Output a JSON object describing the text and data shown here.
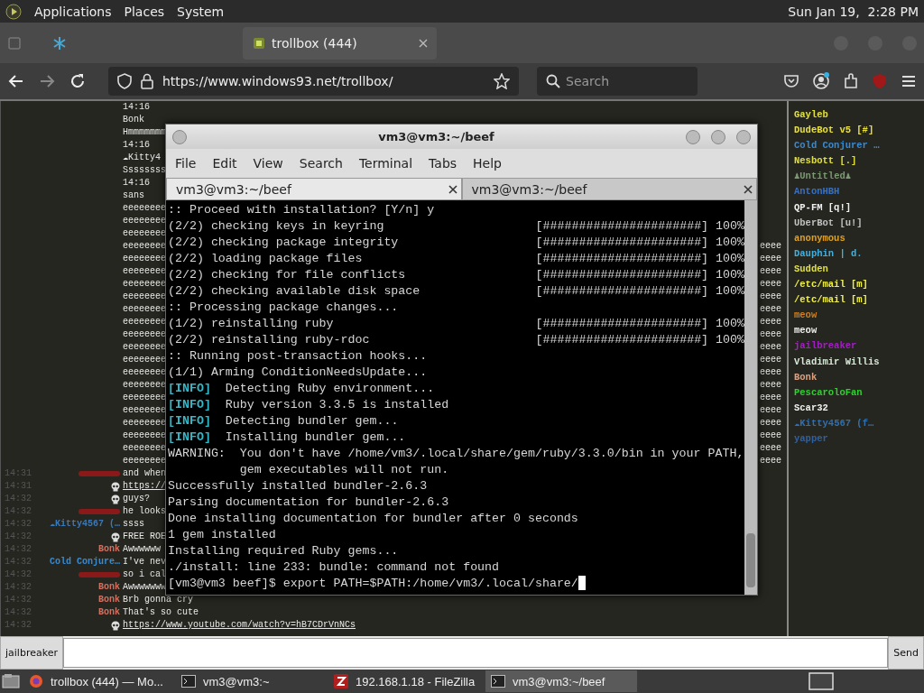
{
  "panel": {
    "menus": [
      "Applications",
      "Places",
      "System"
    ],
    "clock": "Sun Jan 19,  2:28 PM"
  },
  "browser": {
    "tabs": [
      {
        "selected": false
      },
      {
        "title": "trollbox (444)",
        "selected": true
      }
    ],
    "url": "https://www.windows93.net/trollbox/",
    "search": {
      "placeholder": "Search"
    }
  },
  "chat": {
    "lines": [
      {
        "text": "14:16"
      },
      {
        "text": "Bonk"
      },
      {
        "text": "Hmmmmmmm"
      },
      {
        "text": "14:16"
      },
      {
        "text": "☁Kitty4"
      },
      {
        "text": "Ssssssss"
      },
      {
        "text": "14:16"
      },
      {
        "text": "sans"
      },
      {
        "text": "eeeeeeee"
      },
      {
        "text": "eeeeeeee"
      },
      {
        "text": "eeeeeeee"
      },
      {
        "text": "eeeeeeee",
        "tail": "eeee"
      },
      {
        "text": "eeeeeeee",
        "tail": "eeee"
      },
      {
        "text": "eeeeeeee",
        "tail": "eeee"
      },
      {
        "text": "eeeeeeee",
        "tail": "eeee"
      },
      {
        "text": "eeeeeeee",
        "tail": "eeee"
      },
      {
        "text": "eeeeeeee",
        "tail": "eeee"
      },
      {
        "text": "eeeeeeee",
        "tail": "eeee"
      },
      {
        "text": "eeeeeeee",
        "tail": "eeee"
      },
      {
        "text": "eeeeeeee",
        "tail": "eeee"
      },
      {
        "text": "eeeeeeee",
        "tail": "eeee"
      },
      {
        "text": "eeeeeeee",
        "tail": "eeee"
      },
      {
        "text": "eeeeeeee",
        "tail": "eeee"
      },
      {
        "text": "eeeeeeee",
        "tail": "eeee"
      },
      {
        "text": "eeeeeeee",
        "tail": "eeee"
      },
      {
        "text": "eeeeeeee",
        "tail": "eeee"
      },
      {
        "text": "eeeeeeee",
        "tail": "eeee"
      },
      {
        "text": "eeeeeeee",
        "tail": "eeee"
      },
      {
        "text": "eeeeeeee",
        "tail": "eeee"
      }
    ],
    "messages": [
      {
        "time": "14:31",
        "kind": "hidden",
        "text": "and when"
      },
      {
        "time": "14:31",
        "kind": "skull",
        "text": "https://",
        "link": true
      },
      {
        "time": "14:32",
        "kind": "skull",
        "text": "guys?"
      },
      {
        "time": "14:32",
        "kind": "hidden",
        "text": "he looks"
      },
      {
        "time": "14:32",
        "kind": "name",
        "name": "☁Kitty4567 (…",
        "color": "#3a78b8",
        "text": "ssss"
      },
      {
        "time": "14:32",
        "kind": "skull",
        "text": "FREE ROE"
      },
      {
        "time": "14:32",
        "kind": "name",
        "name": "Bonk",
        "color": "#d07060",
        "text": "Awwwwww"
      },
      {
        "time": "14:32",
        "kind": "name",
        "name": "Cold Conjure…",
        "color": "#3a8ad0",
        "text": "I've nev"
      },
      {
        "time": "14:32",
        "kind": "hidden",
        "text": "so i cal"
      },
      {
        "time": "14:32",
        "kind": "name",
        "name": "Bonk",
        "color": "#d07060",
        "text": "Awwwwwww"
      },
      {
        "time": "14:32",
        "kind": "name",
        "name": "Bonk",
        "color": "#d07060",
        "text": "Brb gonna cry"
      },
      {
        "time": "14:32",
        "kind": "name",
        "name": "Bonk",
        "color": "#d07060",
        "text": "That's so cute"
      },
      {
        "time": "14:32",
        "kind": "skull",
        "text": "https://www.youtube.com/watch?v=hB7CDrVnNCs",
        "link": true
      }
    ]
  },
  "users": [
    {
      "name": "Gayleb",
      "color": "#e0e040"
    },
    {
      "name": "DudeBot v5 [#]",
      "color": "#e8e040"
    },
    {
      "name": "Cold Conjurer …",
      "color": "#3a8ad0"
    },
    {
      "name": "Nesbott [.]",
      "color": "#e0e040"
    },
    {
      "name": "♟Untitled♟",
      "color": "#7a9a70"
    },
    {
      "name": "AntonHBH",
      "color": "#3a70c0"
    },
    {
      "name": "QP-FM [q!]",
      "color": "#f0f0f0"
    },
    {
      "name": "UberBot [u!]",
      "color": "#c0c0c0"
    },
    {
      "name": "anonymous",
      "color": "#e0a020"
    },
    {
      "name": "Dauphin | d.",
      "color": "#40b0e0"
    },
    {
      "name": "Sudden",
      "color": "#e0e040"
    },
    {
      "name": "/etc/mail [m]",
      "color": "#f0f040"
    },
    {
      "name": "/etc/mail [m]",
      "color": "#f0f040"
    },
    {
      "name": "meow",
      "color": "#d08020"
    },
    {
      "name": "meow",
      "color": "#f0f0f0"
    },
    {
      "name": "jailbreaker",
      "color": "#a020c0"
    },
    {
      "name": "Vladimir Willis",
      "color": "#d8e8d8"
    },
    {
      "name": "Bonk",
      "color": "#e0a080"
    },
    {
      "name": "PescaroloFan",
      "color": "#30d030"
    },
    {
      "name": "Scar32",
      "color": "#f0f0f0"
    },
    {
      "name": "☁Kitty4567 (f…",
      "color": "#3070b0"
    },
    {
      "name": "yapper",
      "color": "#3060a0"
    }
  ],
  "input": {
    "nick": "jailbreaker",
    "send": "Send"
  },
  "terminal": {
    "title": "vm3@vm3:~/beef",
    "menus": [
      "File",
      "Edit",
      "View",
      "Search",
      "Terminal",
      "Tabs",
      "Help"
    ],
    "tabs": [
      {
        "title": "vm3@vm3:~/beef",
        "selected": true
      },
      {
        "title": "vm3@vm3:~/beef",
        "selected": false
      }
    ],
    "lines": [
      {
        "kind": "plain",
        "text": ":: Proceed with installation? [Y/n] y"
      },
      {
        "kind": "progress",
        "text": "(2/2) checking keys in keyring",
        "bar": "[######################]",
        "percent": "100%"
      },
      {
        "kind": "progress",
        "text": "(2/2) checking package integrity",
        "bar": "[######################]",
        "percent": "100%"
      },
      {
        "kind": "progress",
        "text": "(2/2) loading package files",
        "bar": "[######################]",
        "percent": "100%"
      },
      {
        "kind": "progress",
        "text": "(2/2) checking for file conflicts",
        "bar": "[######################]",
        "percent": "100%"
      },
      {
        "kind": "progress",
        "text": "(2/2) checking available disk space",
        "bar": "[######################]",
        "percent": "100%"
      },
      {
        "kind": "plain",
        "text": ":: Processing package changes..."
      },
      {
        "kind": "progress",
        "text": "(1/2) reinstalling ruby",
        "bar": "[######################]",
        "percent": "100%"
      },
      {
        "kind": "progress",
        "text": "(2/2) reinstalling ruby-rdoc",
        "bar": "[######################]",
        "percent": "100%"
      },
      {
        "kind": "plain",
        "text": ":: Running post-transaction hooks..."
      },
      {
        "kind": "plain",
        "text": "(1/1) Arming ConditionNeedsUpdate..."
      },
      {
        "kind": "info",
        "tag": "[INFO]",
        "text": "Detecting Ruby environment..."
      },
      {
        "kind": "info",
        "tag": "[INFO]",
        "text": "Ruby version 3.3.5 is installed"
      },
      {
        "kind": "info",
        "tag": "[INFO]",
        "text": "Detecting bundler gem..."
      },
      {
        "kind": "info",
        "tag": "[INFO]",
        "text": "Installing bundler gem..."
      },
      {
        "kind": "plain",
        "text": "WARNING:  You don't have /home/vm3/.local/share/gem/ruby/3.3.0/bin in your PATH,"
      },
      {
        "kind": "plain",
        "text": "          gem executables will not run."
      },
      {
        "kind": "plain",
        "text": "Successfully installed bundler-2.6.3"
      },
      {
        "kind": "plain",
        "text": "Parsing documentation for bundler-2.6.3"
      },
      {
        "kind": "plain",
        "text": "Done installing documentation for bundler after 0 seconds"
      },
      {
        "kind": "plain",
        "text": "1 gem installed"
      },
      {
        "kind": "plain",
        "text": "Installing required Ruby gems..."
      },
      {
        "kind": "plain",
        "text": "./install: line 233: bundle: command not found"
      },
      {
        "kind": "prompt",
        "text": "[vm3@vm3 beef]$ export PATH=$PATH:/home/vm3/.local/share/"
      }
    ]
  },
  "taskbar": {
    "items": [
      {
        "kind": "browser",
        "title": "trollbox (444) — Mo...",
        "selected": false
      },
      {
        "kind": "terminal",
        "title": "vm3@vm3:~",
        "selected": false
      },
      {
        "kind": "filezilla",
        "title": "192.168.1.18 - FileZilla",
        "selected": false
      },
      {
        "kind": "terminal",
        "title": "vm3@vm3:~/beef",
        "selected": true
      }
    ]
  }
}
